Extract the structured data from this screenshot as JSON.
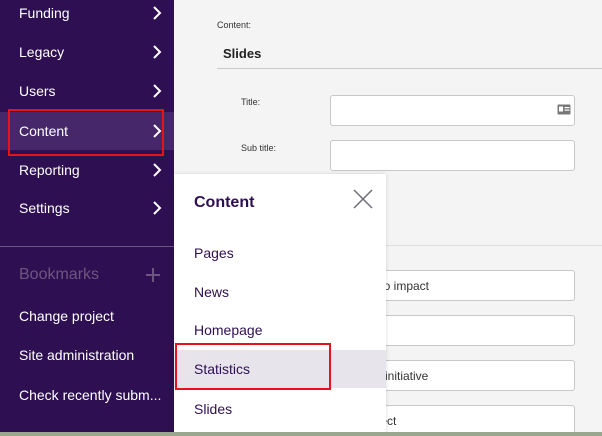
{
  "sidebar": {
    "nav_items": [
      {
        "label": "Funding"
      },
      {
        "label": "Legacy"
      },
      {
        "label": "Users"
      },
      {
        "label": "Content"
      },
      {
        "label": "Reporting"
      },
      {
        "label": "Settings"
      }
    ],
    "bookmarks_label": "Bookmarks",
    "links": [
      {
        "label": "Change project"
      },
      {
        "label": "Site administration"
      },
      {
        "label": "Check recently subm..."
      }
    ]
  },
  "form": {
    "content_label": "Content:",
    "section_title": "Slides",
    "title_label": "Title:",
    "subtitle_label": "Sub title:",
    "partial_values": [
      "y to impact",
      "ur initiative",
      "oject"
    ]
  },
  "dropdown": {
    "title": "Content",
    "items": [
      {
        "label": "Pages"
      },
      {
        "label": "News"
      },
      {
        "label": "Homepage"
      },
      {
        "label": "Statistics"
      },
      {
        "label": "Slides"
      }
    ]
  },
  "colors": {
    "sidebar_bg": "#2e1052",
    "accent_text": "#2e1052",
    "highlight_red": "#e8121d",
    "active_item_bg": "#e7e4ec"
  }
}
